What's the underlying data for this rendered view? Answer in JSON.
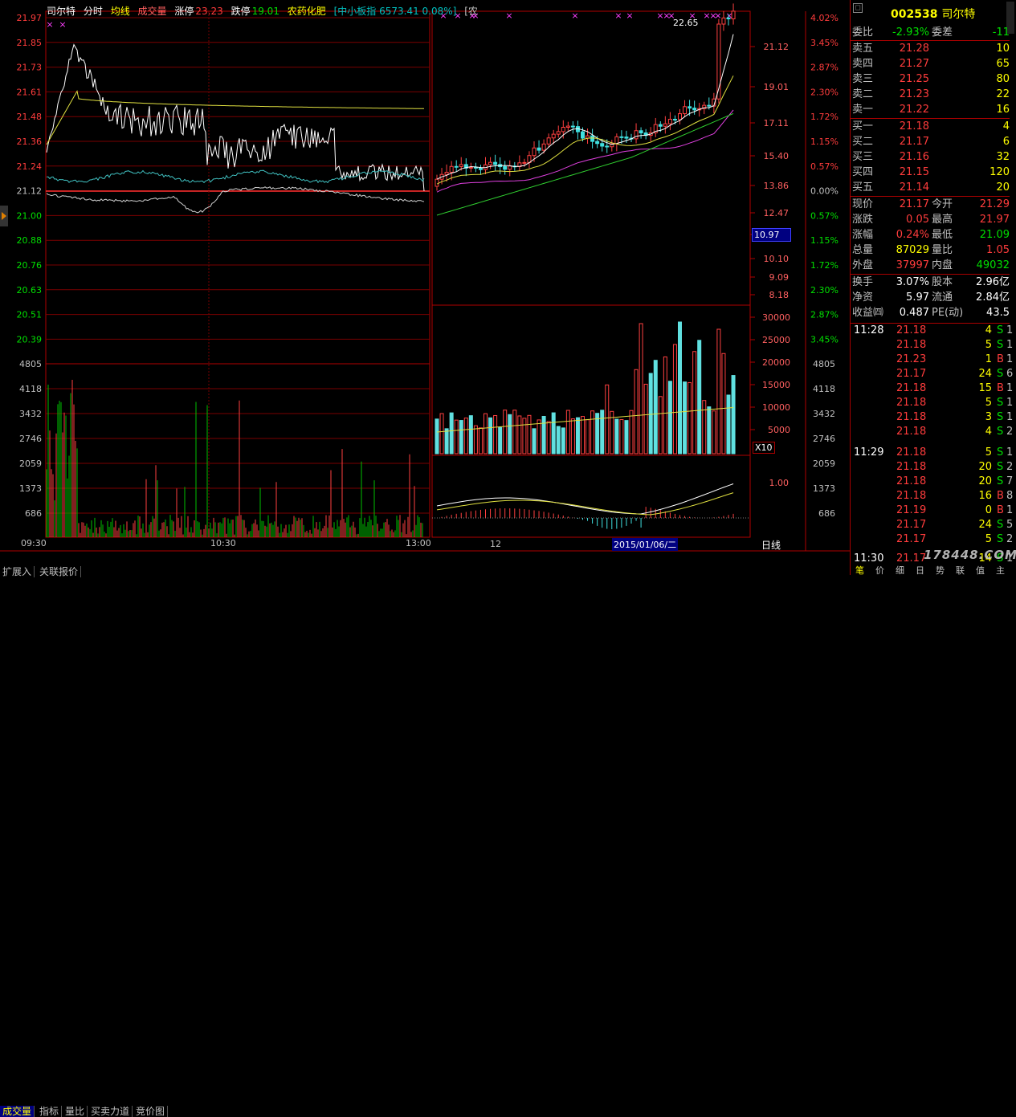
{
  "header": {
    "stock_name": "司尔特",
    "mode_label": "分时",
    "avg_label": "均线",
    "volume_label": "成交量",
    "limit_up_label": "涨停",
    "limit_up_value": "23.23",
    "limit_down_label": "跌停",
    "limit_down_value": "19.01",
    "sector": "农药化肥",
    "index_text": "[中小板指 6573.41 0.08%]",
    "overflow_text": "[农"
  },
  "intraday": {
    "price_ticks": [
      "21.97",
      "21.85",
      "21.73",
      "21.61",
      "21.48",
      "21.36",
      "21.24",
      "21.12",
      "21.00",
      "20.88",
      "20.76",
      "20.63",
      "20.51",
      "20.39"
    ],
    "vol_ticks": [
      "4805",
      "4118",
      "3432",
      "2746",
      "2059",
      "1373",
      "686"
    ],
    "time_ticks": [
      "09:30",
      "10:30",
      "13:00"
    ]
  },
  "kline": {
    "right_price_ticks": [
      "21.12",
      "19.01",
      "17.11",
      "15.40",
      "13.86",
      "12.47",
      "11.22",
      "10.10",
      "9.09",
      "8.18"
    ],
    "pct_ticks": [
      "4.02%",
      "3.45%",
      "2.87%",
      "2.30%",
      "1.72%",
      "1.15%",
      "0.57%",
      "0.00%",
      "0.57%",
      "1.15%",
      "1.72%",
      "2.30%",
      "2.87%",
      "3.45%"
    ],
    "right_vol_pct_ticks": [
      "4805",
      "4118",
      "3432",
      "2746",
      "2059",
      "1373",
      "686"
    ],
    "vol_ticks": [
      "30000",
      "25000",
      "20000",
      "15000",
      "10000",
      "5000"
    ],
    "vol_multiplier": "X10",
    "macd_tick": "1.00",
    "high_label": "22.65",
    "low_box": "10.97",
    "date_label_12": "12",
    "date_cursor": "2015/01/06/二",
    "period_label": "日线",
    "zoom_in": "+",
    "zoom_out": "-",
    "zero": "0"
  },
  "bottom_tabs": [
    "成交量",
    "指标",
    "量比",
    "买卖力道",
    "竞价图"
  ],
  "bottom_tabs2": [
    "扩展入",
    "关联报价"
  ],
  "right_panel": {
    "code": "002538",
    "name": "司尔特",
    "weibi_label": "委比",
    "weibi_value": "-2.93%",
    "weicha_label": "委差",
    "weicha_value": "-11",
    "sell": [
      {
        "label": "卖五",
        "price": "21.28",
        "vol": "10"
      },
      {
        "label": "卖四",
        "price": "21.27",
        "vol": "65"
      },
      {
        "label": "卖三",
        "price": "21.25",
        "vol": "80"
      },
      {
        "label": "卖二",
        "price": "21.23",
        "vol": "22"
      },
      {
        "label": "卖一",
        "price": "21.22",
        "vol": "16"
      }
    ],
    "buy": [
      {
        "label": "买一",
        "price": "21.18",
        "vol": "4"
      },
      {
        "label": "买二",
        "price": "21.17",
        "vol": "6"
      },
      {
        "label": "买三",
        "price": "21.16",
        "vol": "32"
      },
      {
        "label": "买四",
        "price": "21.15",
        "vol": "120"
      },
      {
        "label": "买五",
        "price": "21.14",
        "vol": "20"
      }
    ],
    "stats": [
      {
        "l1": "现价",
        "v1": "21.17",
        "l2": "今开",
        "v2": "21.29",
        "c1": "#ff3c3c",
        "c2": "#ff3c3c"
      },
      {
        "l1": "涨跌",
        "v1": "0.05",
        "l2": "最高",
        "v2": "21.97",
        "c1": "#ff3c3c",
        "c2": "#ff3c3c"
      },
      {
        "l1": "涨幅",
        "v1": "0.24%",
        "l2": "最低",
        "v2": "21.09",
        "c1": "#ff3c3c",
        "c2": "#00e000"
      },
      {
        "l1": "总量",
        "v1": "87029",
        "l2": "量比",
        "v2": "1.05",
        "c1": "#ffff00",
        "c2": "#ff3c3c"
      },
      {
        "l1": "外盘",
        "v1": "37997",
        "l2": "内盘",
        "v2": "49032",
        "c1": "#ff3c3c",
        "c2": "#00e000"
      }
    ],
    "stats2": [
      {
        "l1": "换手",
        "v1": "3.07%",
        "l2": "股本",
        "v2": "2.96亿"
      },
      {
        "l1": "净资",
        "v1": "5.97",
        "l2": "流通",
        "v2": "2.84亿"
      },
      {
        "l1": "收益㈣",
        "v1": "0.487",
        "l2": "PE(动)",
        "v2": "43.5"
      }
    ],
    "ticks": [
      {
        "time": "11:28",
        "price": "21.18",
        "vol": "4",
        "flag": "S",
        "n": "1"
      },
      {
        "time": "",
        "price": "21.18",
        "vol": "5",
        "flag": "S",
        "n": "1"
      },
      {
        "time": "",
        "price": "21.23",
        "vol": "1",
        "flag": "B",
        "n": "1"
      },
      {
        "time": "",
        "price": "21.17",
        "vol": "24",
        "flag": "S",
        "n": "6"
      },
      {
        "time": "",
        "price": "21.18",
        "vol": "15",
        "flag": "B",
        "n": "1"
      },
      {
        "time": "",
        "price": "21.18",
        "vol": "5",
        "flag": "S",
        "n": "1"
      },
      {
        "time": "",
        "price": "21.18",
        "vol": "3",
        "flag": "S",
        "n": "1"
      },
      {
        "time": "",
        "price": "21.18",
        "vol": "4",
        "flag": "S",
        "n": "2"
      },
      {
        "time": "11:29",
        "price": "21.18",
        "vol": "5",
        "flag": "S",
        "n": "1"
      },
      {
        "time": "",
        "price": "21.18",
        "vol": "20",
        "flag": "S",
        "n": "2"
      },
      {
        "time": "",
        "price": "21.18",
        "vol": "20",
        "flag": "S",
        "n": "7"
      },
      {
        "time": "",
        "price": "21.18",
        "vol": "16",
        "flag": "B",
        "n": "8"
      },
      {
        "time": "",
        "price": "21.19",
        "vol": "0",
        "flag": "B",
        "n": "1"
      },
      {
        "time": "",
        "price": "21.17",
        "vol": "24",
        "flag": "S",
        "n": "5"
      },
      {
        "time": "",
        "price": "21.17",
        "vol": "5",
        "flag": "S",
        "n": "2"
      },
      {
        "time": "11:30",
        "price": "21.17",
        "vol": "14",
        "flag": "S",
        "n": "1"
      }
    ],
    "bottom_tabs": [
      "笔",
      "价",
      "细",
      "日",
      "势",
      "联",
      "值",
      "主"
    ]
  },
  "watermark": "178448.COM"
}
